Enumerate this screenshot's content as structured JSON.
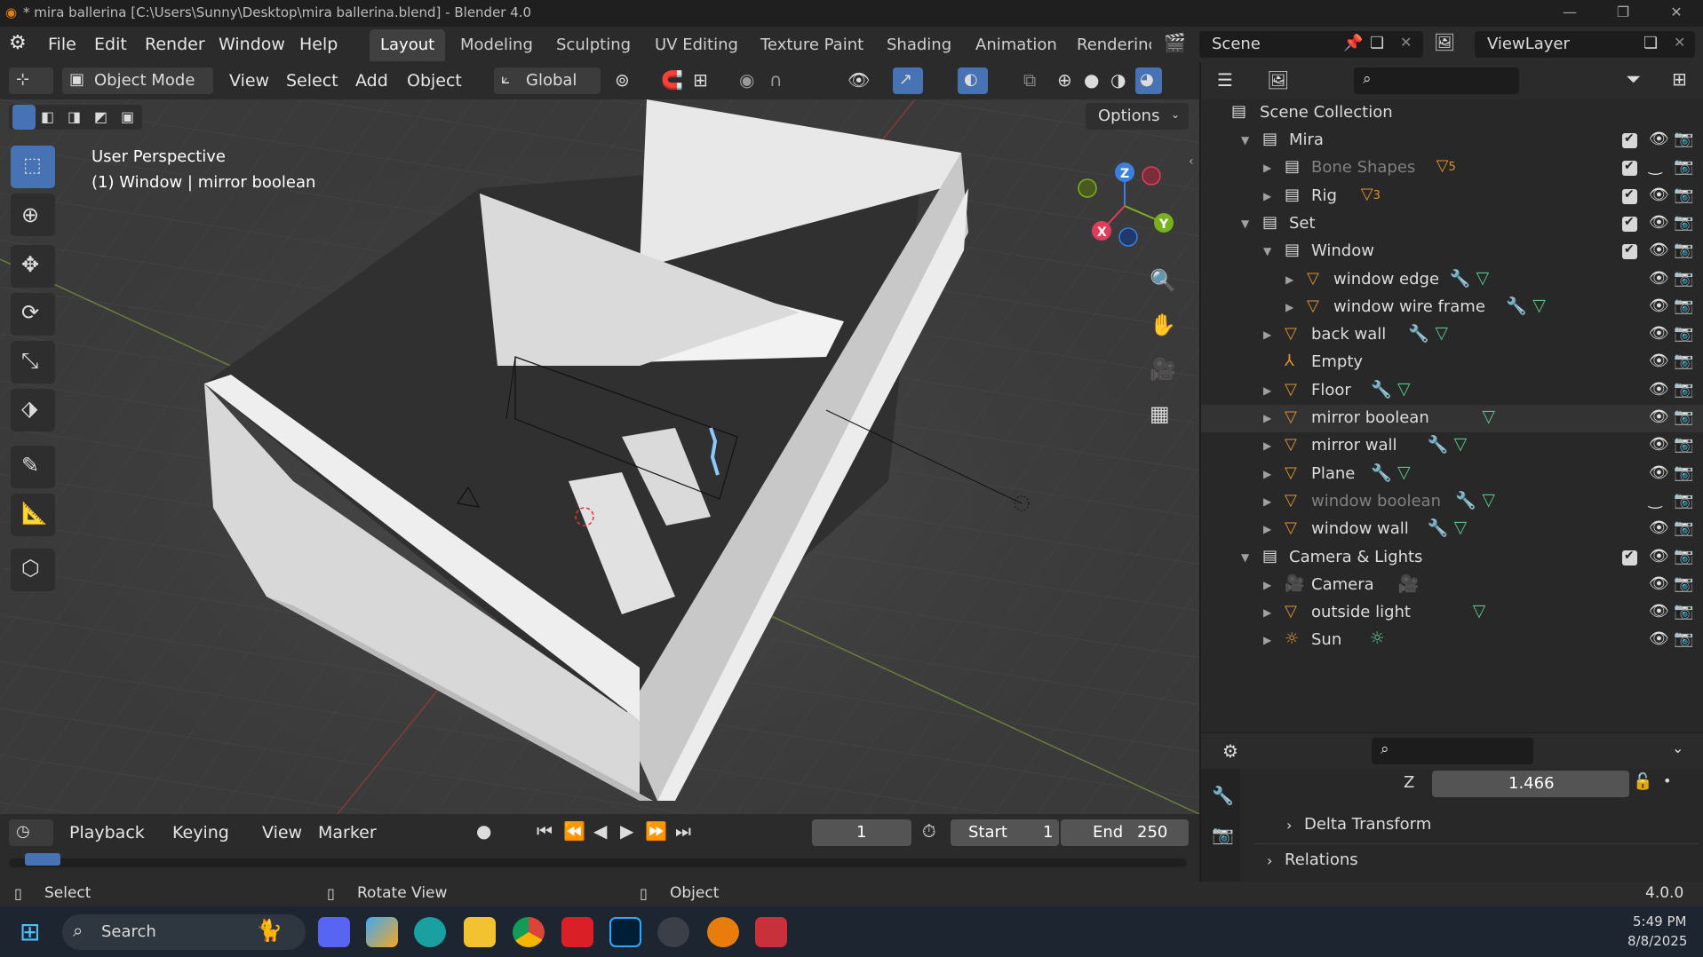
{
  "window": {
    "title": "* mira ballerina [C:\\Users\\Sunny\\Desktop\\mira ballerina.blend] - Blender 4.0"
  },
  "menu": [
    "File",
    "Edit",
    "Render",
    "Window",
    "Help"
  ],
  "workspaces": [
    "Layout",
    "Modeling",
    "Sculpting",
    "UV Editing",
    "Texture Paint",
    "Shading",
    "Animation",
    "Renderinç"
  ],
  "scene": {
    "name": "Scene",
    "view_layer": "ViewLayer"
  },
  "viewport": {
    "mode": "Object Mode",
    "menus": [
      "View",
      "Select",
      "Add",
      "Object"
    ],
    "orientation": "Global",
    "options": "Options",
    "info_line1": "User Perspective",
    "info_line2": "(1) Window | mirror boolean"
  },
  "outliner": {
    "root": "Scene Collection",
    "rows": [
      {
        "label": "Mira",
        "kind": "collection",
        "expanded": true
      },
      {
        "label": "Bone Shapes",
        "kind": "collection",
        "badge": "5"
      },
      {
        "label": "Rig",
        "kind": "collection",
        "badge": "3"
      },
      {
        "label": "Set",
        "kind": "collection",
        "expanded": true
      },
      {
        "label": "Window",
        "kind": "collection",
        "expanded": true
      },
      {
        "label": "window edge",
        "kind": "mesh"
      },
      {
        "label": "window wire frame",
        "kind": "mesh"
      },
      {
        "label": "back wall",
        "kind": "mesh"
      },
      {
        "label": "Empty",
        "kind": "empty"
      },
      {
        "label": "Floor",
        "kind": "mesh"
      },
      {
        "label": "mirror boolean",
        "kind": "mesh"
      },
      {
        "label": "mirror wall",
        "kind": "mesh"
      },
      {
        "label": "Plane",
        "kind": "mesh"
      },
      {
        "label": "window boolean",
        "kind": "mesh"
      },
      {
        "label": "window wall",
        "kind": "mesh"
      },
      {
        "label": "Camera & Lights",
        "kind": "collection",
        "expanded": true
      },
      {
        "label": "Camera",
        "kind": "camera"
      },
      {
        "label": "outside light",
        "kind": "mesh"
      },
      {
        "label": "Sun",
        "kind": "light"
      }
    ]
  },
  "properties": {
    "z_label": "Z",
    "z_value": "1.466",
    "delta_transform": "Delta Transform",
    "relations": "Relations"
  },
  "timeline": {
    "menus": [
      "Playback",
      "Keying",
      "View",
      "Marker"
    ],
    "current_frame": "1",
    "start_label": "Start",
    "start": "1",
    "end_label": "End",
    "end": "250"
  },
  "status": {
    "select": "Select",
    "rotate": "Rotate View",
    "object": "Object",
    "version": "4.0.0"
  },
  "taskbar": {
    "search": "Search",
    "time": "5:49 PM",
    "date": "8/8/2025"
  },
  "colors": {
    "accent": "#4772b3",
    "header": "#2b2b2b",
    "panel": "#282828",
    "mesh_icon": "#e0922f",
    "modifier_icon": "#6d8fd8",
    "data_icon": "#58c48a"
  }
}
